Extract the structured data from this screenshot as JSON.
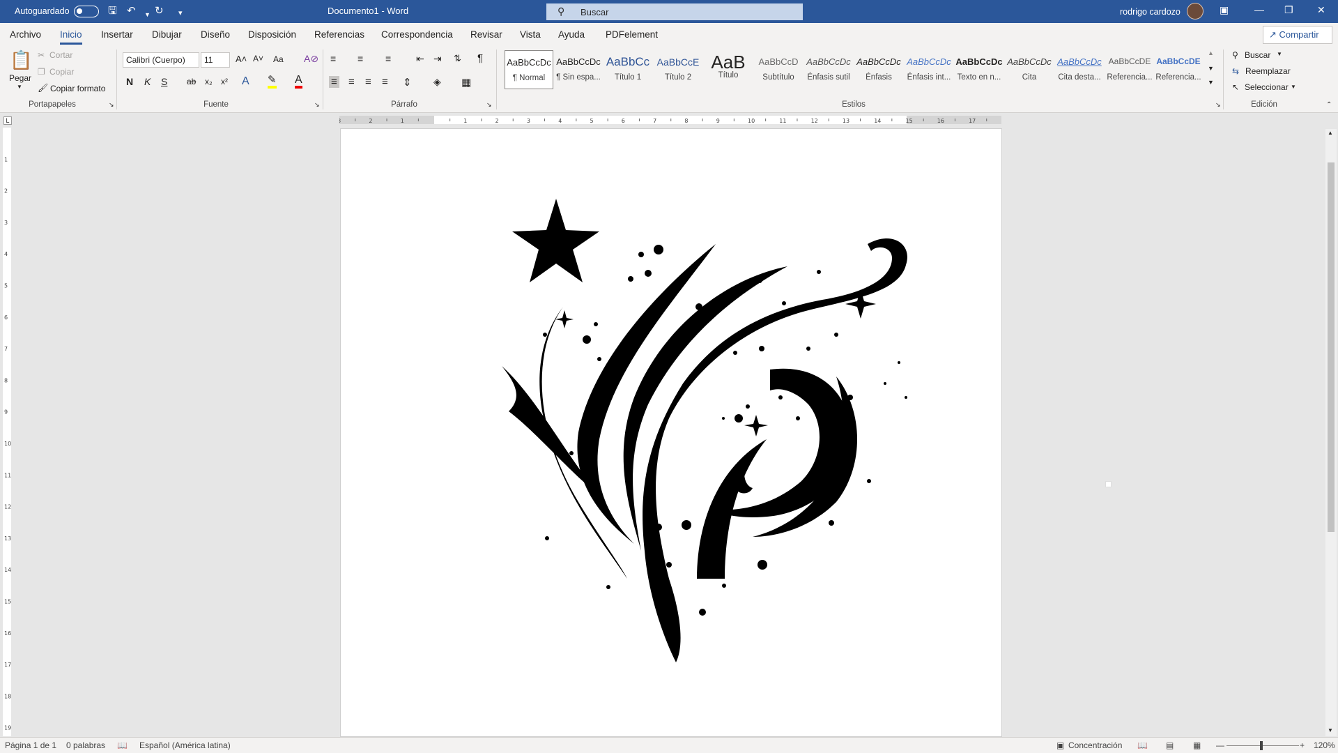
{
  "titlebar": {
    "autosave_label": "Autoguardado",
    "document_title": "Documento1 - Word",
    "search_placeholder": "Buscar",
    "user_name": "rodrigo cardozo",
    "colors": {
      "brand": "#2b579a"
    }
  },
  "menu": {
    "items": [
      "Archivo",
      "Inicio",
      "Insertar",
      "Dibujar",
      "Diseño",
      "Disposición",
      "Referencias",
      "Correspondencia",
      "Revisar",
      "Vista",
      "Ayuda",
      "PDFelement"
    ],
    "active": "Inicio",
    "share_label": "Compartir"
  },
  "ribbon": {
    "clipboard": {
      "paste": "Pegar",
      "cut": "Cortar",
      "copy": "Copiar",
      "format_painter": "Copiar formato",
      "group": "Portapapeles"
    },
    "font": {
      "family": "Calibri (Cuerpo)",
      "size": "11",
      "bold": "N",
      "italic": "K",
      "underline": "S",
      "strike": "ab",
      "sub": "x₂",
      "sup": "x²",
      "case": "Aa",
      "group": "Fuente"
    },
    "paragraph": {
      "group": "Párrafo"
    },
    "styles": {
      "group": "Estilos",
      "items": [
        {
          "preview": "AaBbCcDc",
          "name": "¶ Normal"
        },
        {
          "preview": "AaBbCcDc",
          "name": "¶ Sin espa..."
        },
        {
          "preview": "AaBbCc",
          "name": "Título 1"
        },
        {
          "preview": "AaBbCcE",
          "name": "Título 2"
        },
        {
          "preview": "AaB",
          "name": "Título"
        },
        {
          "preview": "AaBbCcD",
          "name": "Subtítulo"
        },
        {
          "preview": "AaBbCcDc",
          "name": "Énfasis sutil"
        },
        {
          "preview": "AaBbCcDc",
          "name": "Énfasis"
        },
        {
          "preview": "AaBbCcDc",
          "name": "Énfasis int..."
        },
        {
          "preview": "AaBbCcDc",
          "name": "Texto en n..."
        },
        {
          "preview": "AaBbCcDc",
          "name": "Cita"
        },
        {
          "preview": "AaBbCcDc",
          "name": "Cita desta..."
        },
        {
          "preview": "AaBbCcDE",
          "name": "Referencia..."
        },
        {
          "preview": "AaBbCcDE",
          "name": "Referencia..."
        }
      ]
    },
    "editing": {
      "find": "Buscar",
      "replace": "Reemplazar",
      "select": "Seleccionar",
      "group": "Edición"
    }
  },
  "ruler": {
    "labels": [
      "3",
      "2",
      "1",
      "1",
      "2",
      "3",
      "4",
      "5",
      "6",
      "7",
      "8",
      "9",
      "10",
      "11",
      "12",
      "13",
      "14",
      "15",
      "16",
      "17"
    ]
  },
  "statusbar": {
    "page": "Página 1 de 1",
    "words": "0 palabras",
    "language": "Español (América latina)",
    "focus": "Concentración",
    "zoom": "120%"
  }
}
